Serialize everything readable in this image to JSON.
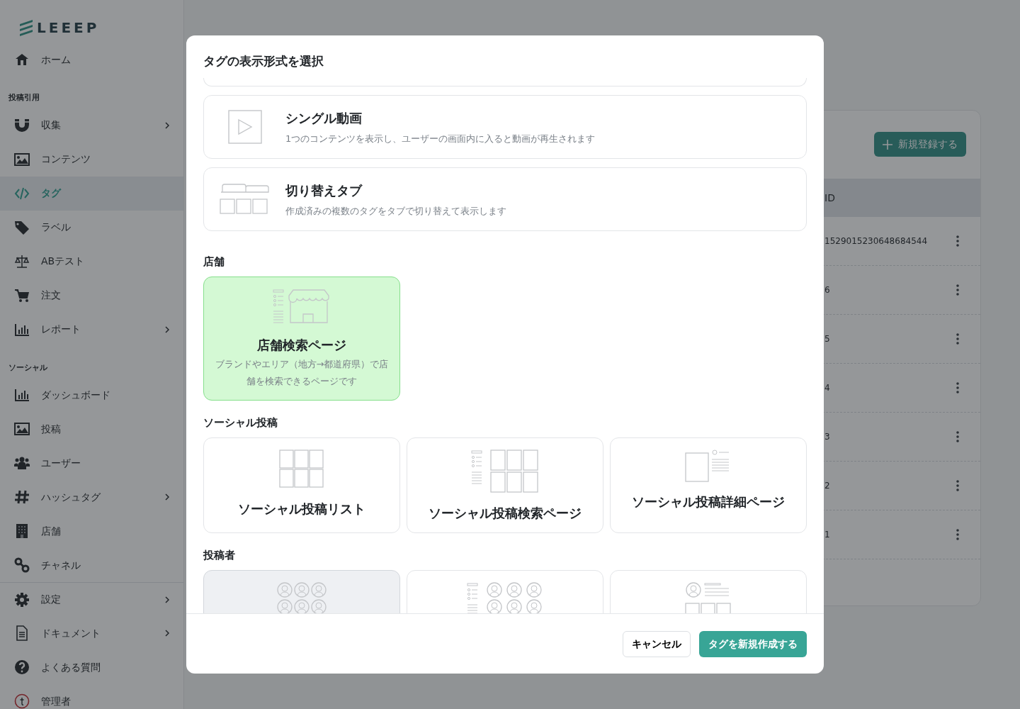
{
  "sidebar": {
    "logo": "LEEEP",
    "groups": [
      {
        "divider": false,
        "items": [
          {
            "label": "ホーム",
            "selected": false,
            "has_submenu": false
          }
        ]
      },
      {
        "divider": false,
        "heading": "投稿引用",
        "items": [
          {
            "label": "収集",
            "selected": false,
            "has_submenu": true
          },
          {
            "label": "コンテンツ",
            "selected": false,
            "has_submenu": false
          },
          {
            "label": "タグ",
            "selected": true,
            "has_submenu": false
          },
          {
            "label": "ラベル",
            "selected": false,
            "has_submenu": false
          },
          {
            "label": "ABテスト",
            "selected": false,
            "has_submenu": false
          },
          {
            "label": "注文",
            "selected": false,
            "has_submenu": false
          },
          {
            "label": "レポート",
            "selected": false,
            "has_submenu": true
          }
        ]
      },
      {
        "divider": false,
        "heading": "ソーシャル",
        "items": [
          {
            "label": "ダッシュボード",
            "selected": false,
            "has_submenu": false
          },
          {
            "label": "投稿",
            "selected": false,
            "has_submenu": false
          },
          {
            "label": "ユーザー",
            "selected": false,
            "has_submenu": false
          },
          {
            "label": "ハッシュタグ",
            "selected": false,
            "has_submenu": true
          },
          {
            "label": "店舗",
            "selected": false,
            "has_submenu": false
          },
          {
            "label": "チャネル",
            "selected": false,
            "has_submenu": false
          }
        ]
      },
      {
        "divider": true,
        "items": [
          {
            "label": "設定",
            "selected": false,
            "has_submenu": true
          },
          {
            "label": "ドキュメント",
            "selected": false,
            "has_submenu": true
          },
          {
            "label": "よくある質問",
            "selected": false,
            "has_submenu": false
          },
          {
            "label": "管理者",
            "selected": false,
            "has_submenu": false
          }
        ]
      }
    ]
  },
  "main": {
    "new_button": "新規登録する",
    "table": {
      "columns": [
        "ID"
      ],
      "rows": [
        [
          "1529015230648684544"
        ],
        [
          "6"
        ],
        [
          "5"
        ],
        [
          "4"
        ],
        [
          "3"
        ],
        [
          "2"
        ],
        [
          "1"
        ]
      ]
    }
  },
  "modal": {
    "title": "タグの表示形式を選択",
    "sections": [
      {
        "kind": "list",
        "options": [
          {
            "kind": "video",
            "title": "シングル動画",
            "description": "1つのコンテンツを表示し、ユーザーの画面内に入ると動画が再生されます",
            "selected": false
          },
          {
            "kind": "tabs",
            "title": "切り替えタブ",
            "description": "作成済みの複数のタグをタブで切り替えて表示します",
            "selected": false
          }
        ]
      },
      {
        "kind": "grid",
        "heading": "店舗",
        "options": [
          {
            "kind": "store",
            "title": "店舗検索ページ",
            "description": "ブランドやエリア（地方→都道府県）で店舗を検索できるページです",
            "selected": true,
            "hovered": false
          }
        ]
      },
      {
        "kind": "grid",
        "heading": "ソーシャル投稿",
        "options": [
          {
            "kind": "post-grid",
            "title": "ソーシャル投稿リスト",
            "selected": false,
            "hovered": false
          },
          {
            "kind": "post-search",
            "title": "ソーシャル投稿検索ページ",
            "selected": false,
            "hovered": false
          },
          {
            "kind": "post-detail",
            "title": "ソーシャル投稿詳細ページ",
            "selected": false,
            "hovered": false
          }
        ]
      },
      {
        "kind": "grid",
        "heading": "投稿者",
        "options": [
          {
            "kind": "author-grid",
            "selected": false,
            "hovered": true
          },
          {
            "kind": "author-search",
            "selected": false,
            "hovered": false
          },
          {
            "kind": "author-detail",
            "selected": false,
            "hovered": false
          }
        ]
      }
    ],
    "buttons": [
      {
        "label": "キャンセル",
        "kind": "secondary"
      },
      {
        "label": "タグを新規作成する",
        "kind": "primary"
      }
    ]
  }
}
